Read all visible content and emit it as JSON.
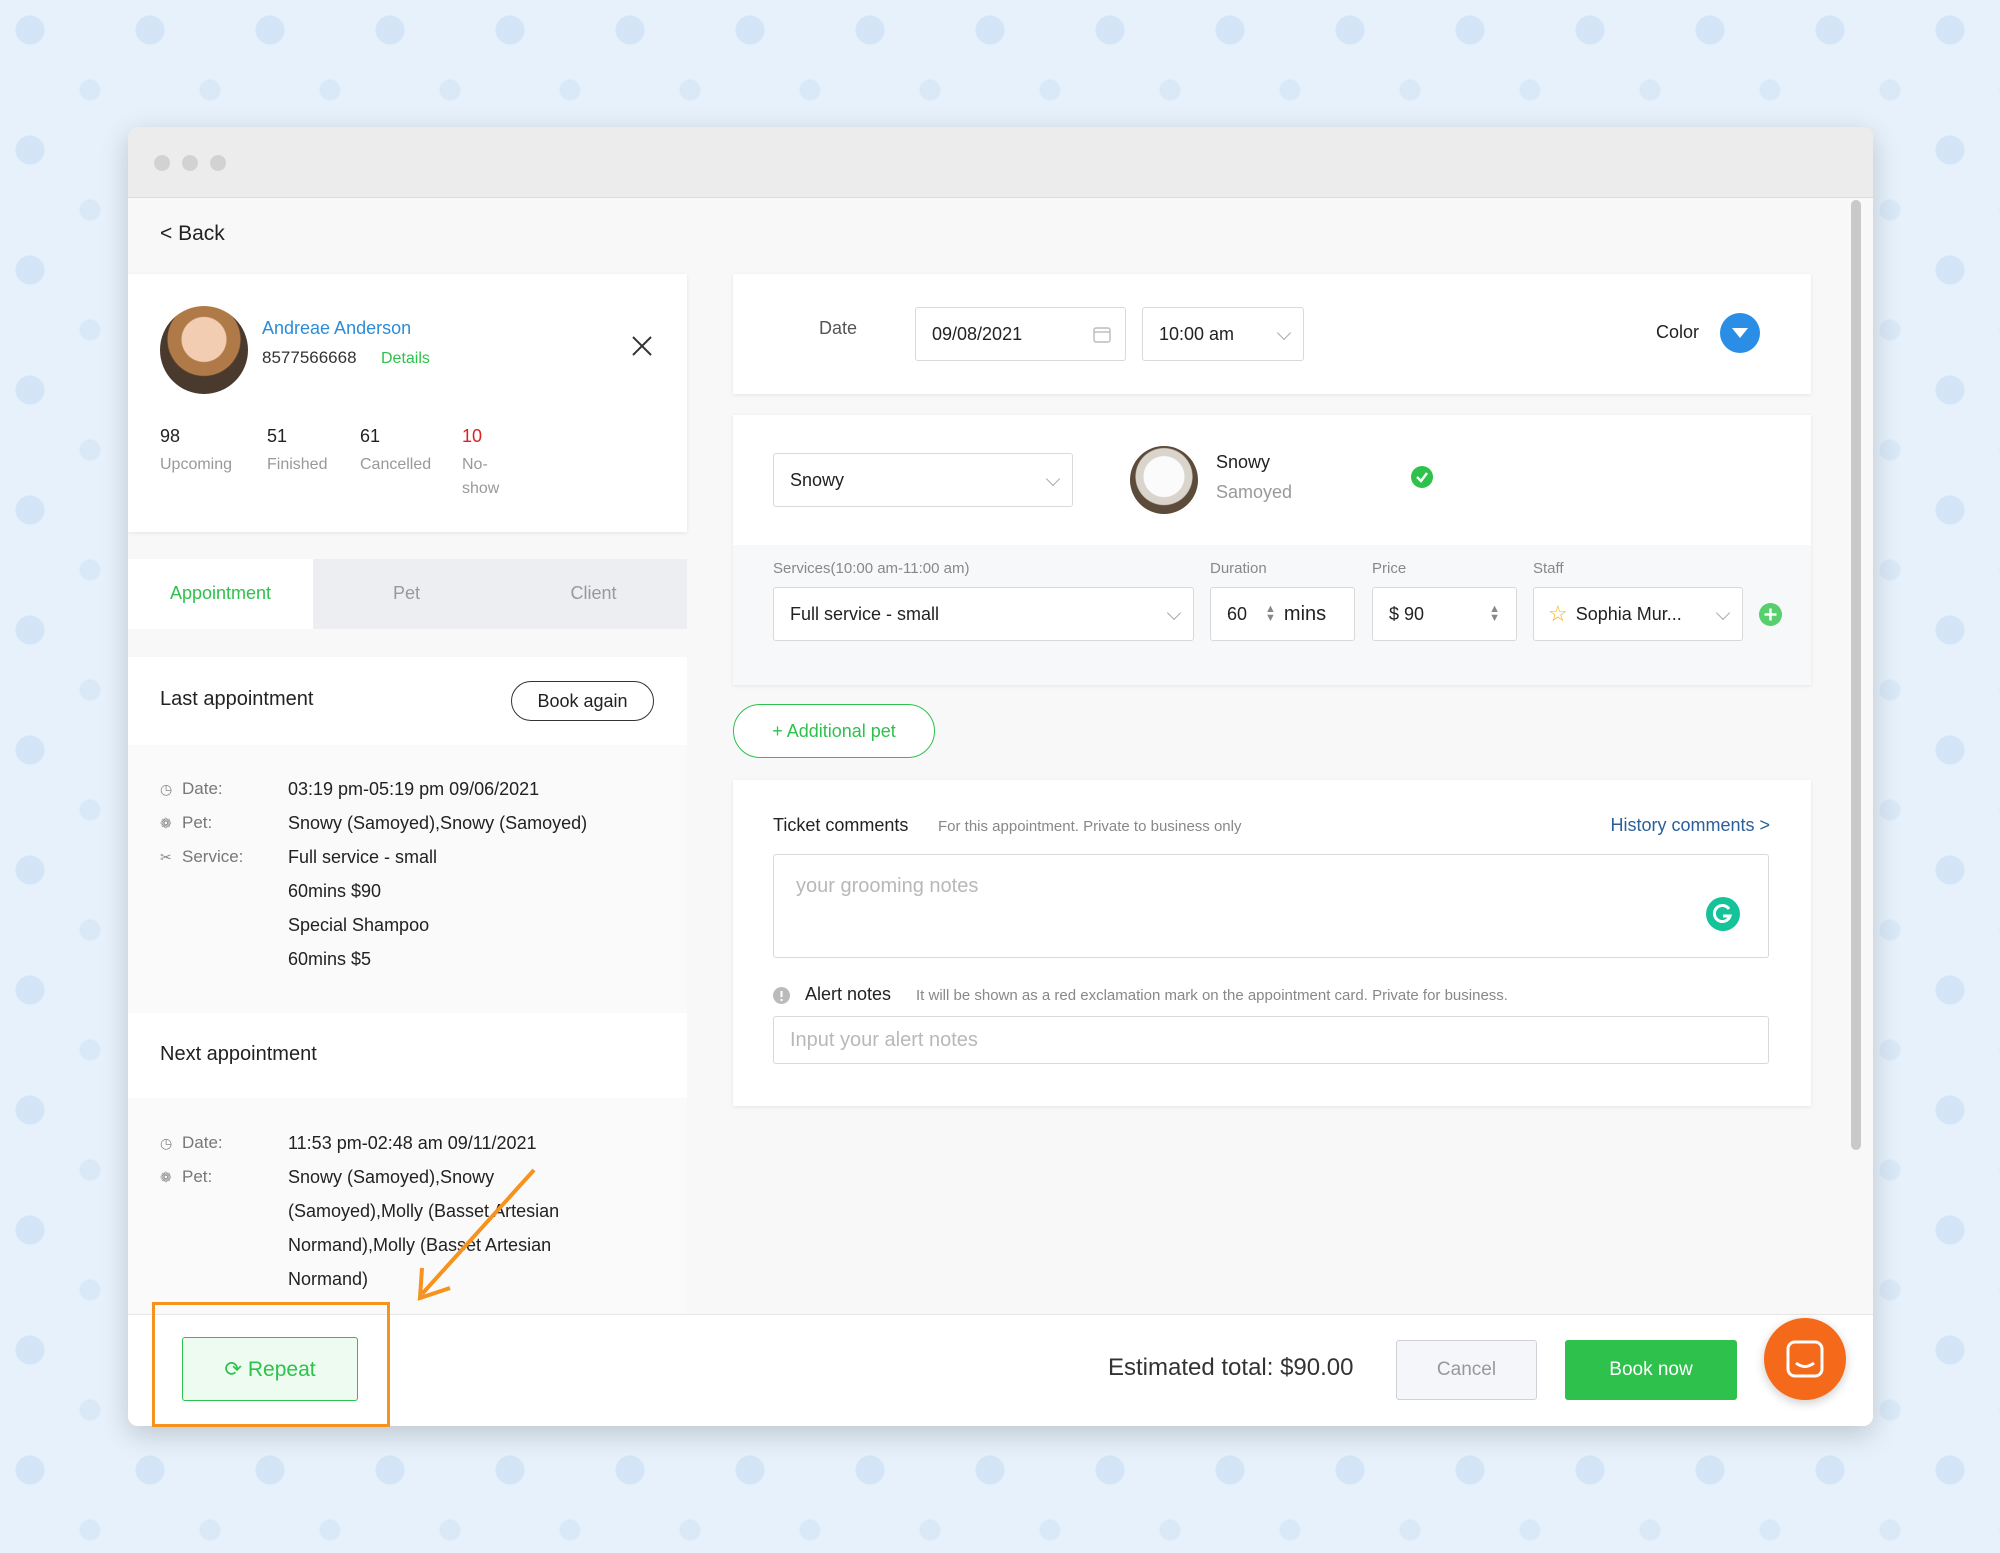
{
  "back_label": "< Back",
  "client": {
    "name": "Andreae Anderson",
    "phone": "8577566668",
    "details_link": "Details"
  },
  "stats": [
    {
      "num": "98",
      "label": "Upcoming"
    },
    {
      "num": "51",
      "label": "Finished"
    },
    {
      "num": "61",
      "label": "Cancelled"
    },
    {
      "num": "10",
      "label_line1": "No-",
      "label_line2": "show"
    }
  ],
  "tabs": {
    "appointment": "Appointment",
    "pet": "Pet",
    "client": "Client"
  },
  "last_appt": {
    "title": "Last appointment",
    "book_again": "Book again",
    "date_key": "Date:",
    "date_val": "03:19 pm-05:19 pm 09/06/2021",
    "pet_key": "Pet:",
    "pet_val": "Snowy (Samoyed),Snowy (Samoyed)",
    "service_key": "Service:",
    "service_lines": [
      "Full service - small",
      "60mins  $90",
      "Special Shampoo",
      "60mins  $5"
    ]
  },
  "next_appt": {
    "title": "Next appointment",
    "date_key": "Date:",
    "date_val": "11:53 pm-02:48 am 09/11/2021",
    "pet_key": "Pet:",
    "pet_lines": [
      "Snowy (Samoyed),Snowy",
      "(Samoyed),Molly (Basset Artesian",
      "Normand),Molly (Basset Artesian",
      "Normand)"
    ]
  },
  "schedule": {
    "date_label": "Date",
    "date_value": "09/08/2021",
    "time_value": "10:00 am",
    "color_label": "Color"
  },
  "pet": {
    "select_value": "Snowy",
    "name": "Snowy",
    "breed": "Samoyed"
  },
  "service": {
    "services_label": "Services(10:00 am-11:00 am)",
    "service_value": "Full service - small",
    "duration_label": "Duration",
    "duration_value": "60",
    "duration_unit": "mins",
    "price_label": "Price",
    "price_value": "$ 90",
    "staff_label": "Staff",
    "staff_value": "Sophia Mur..."
  },
  "additional_pet": "+ Additional pet",
  "comments": {
    "ticket_label": "Ticket comments",
    "ticket_hint": "For this appointment. Private to business only",
    "history_link": "History comments >",
    "grooming_placeholder": "your grooming notes",
    "alert_label": "Alert notes",
    "alert_hint": "It will be shown as a red exclamation mark on the appointment card. Private for business.",
    "alert_placeholder": "Input your alert notes"
  },
  "footer": {
    "repeat": "Repeat",
    "estimated_total": "Estimated total: $90.00",
    "cancel": "Cancel",
    "book_now": "Book now"
  },
  "colors": {
    "accent_green": "#2ec14b",
    "link_blue": "#2b8dd8",
    "annotation_orange": "#f6921e",
    "chat_orange": "#f46a1a",
    "color_picker_blue": "#2a8ee6"
  }
}
